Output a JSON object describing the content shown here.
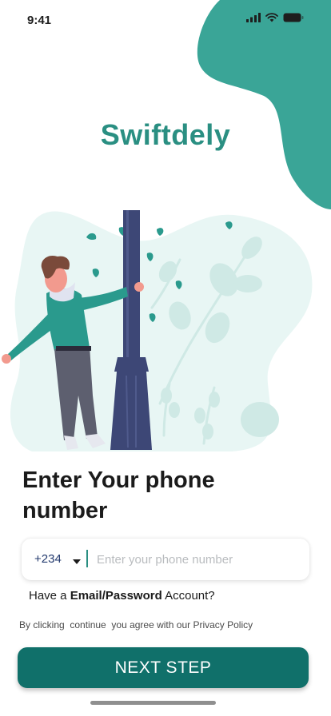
{
  "status_bar": {
    "time": "9:41",
    "icons": [
      "signal-icon",
      "wifi-icon",
      "battery-icon"
    ]
  },
  "brand": {
    "name": "Swiftdely",
    "color": "#2a8f82"
  },
  "illustration": {
    "subject": "person-leaning-on-lamp-post",
    "accent_color": "#2a9a8d"
  },
  "form": {
    "heading": "Enter Your phone number",
    "country_code": "+234",
    "phone_placeholder": "Enter your phone number",
    "phone_value": "",
    "alt_prefix": "Have a ",
    "alt_link": "Email/Password",
    "alt_suffix": " Account?",
    "policy": "By clicking  continue  you agree with our Privacy Policy",
    "next_label": "NEXT STEP"
  },
  "colors": {
    "primary": "#10706a",
    "accent": "#2a8f82",
    "blob": "#3aa597"
  }
}
